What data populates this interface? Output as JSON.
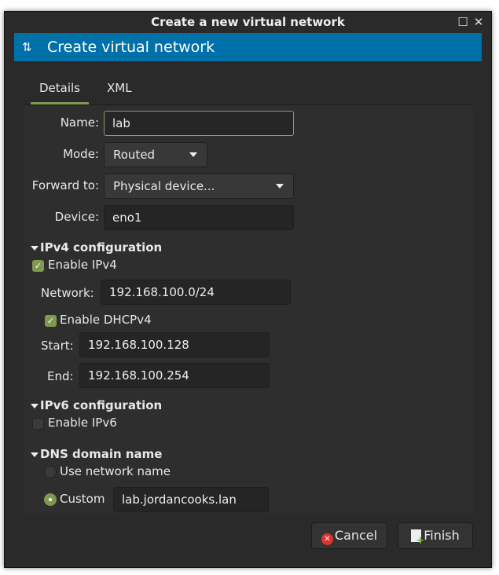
{
  "window": {
    "title": "Create a new virtual network"
  },
  "banner": {
    "title": "Create virtual network"
  },
  "tabs": [
    {
      "label": "Details",
      "active": true
    },
    {
      "label": "XML",
      "active": false
    }
  ],
  "form": {
    "name": {
      "label": "Name:",
      "value": "lab"
    },
    "mode": {
      "label": "Mode:",
      "value": "Routed"
    },
    "forward": {
      "label": "Forward to:",
      "value": "Physical device..."
    },
    "device": {
      "label": "Device:",
      "value": "eno1"
    }
  },
  "ipv4": {
    "header": "IPv4 configuration",
    "enable_label": "Enable IPv4",
    "enabled": true,
    "network_label": "Network:",
    "network": "192.168.100.0/24",
    "dhcp_label": "Enable DHCPv4",
    "dhcp_enabled": true,
    "start_label": "Start:",
    "start": "192.168.100.128",
    "end_label": "End:",
    "end": "192.168.100.254"
  },
  "ipv6": {
    "header": "IPv6 configuration",
    "enable_label": "Enable IPv6",
    "enabled": false
  },
  "dns": {
    "header": "DNS domain name",
    "use_network_label": "Use network name",
    "custom_label": "Custom",
    "custom_value": "lab.jordancooks.lan",
    "selected": "custom"
  },
  "buttons": {
    "cancel": "Cancel",
    "finish": "Finish"
  },
  "colors": {
    "accent": "#7f9a4e",
    "banner": "#0070a8"
  }
}
